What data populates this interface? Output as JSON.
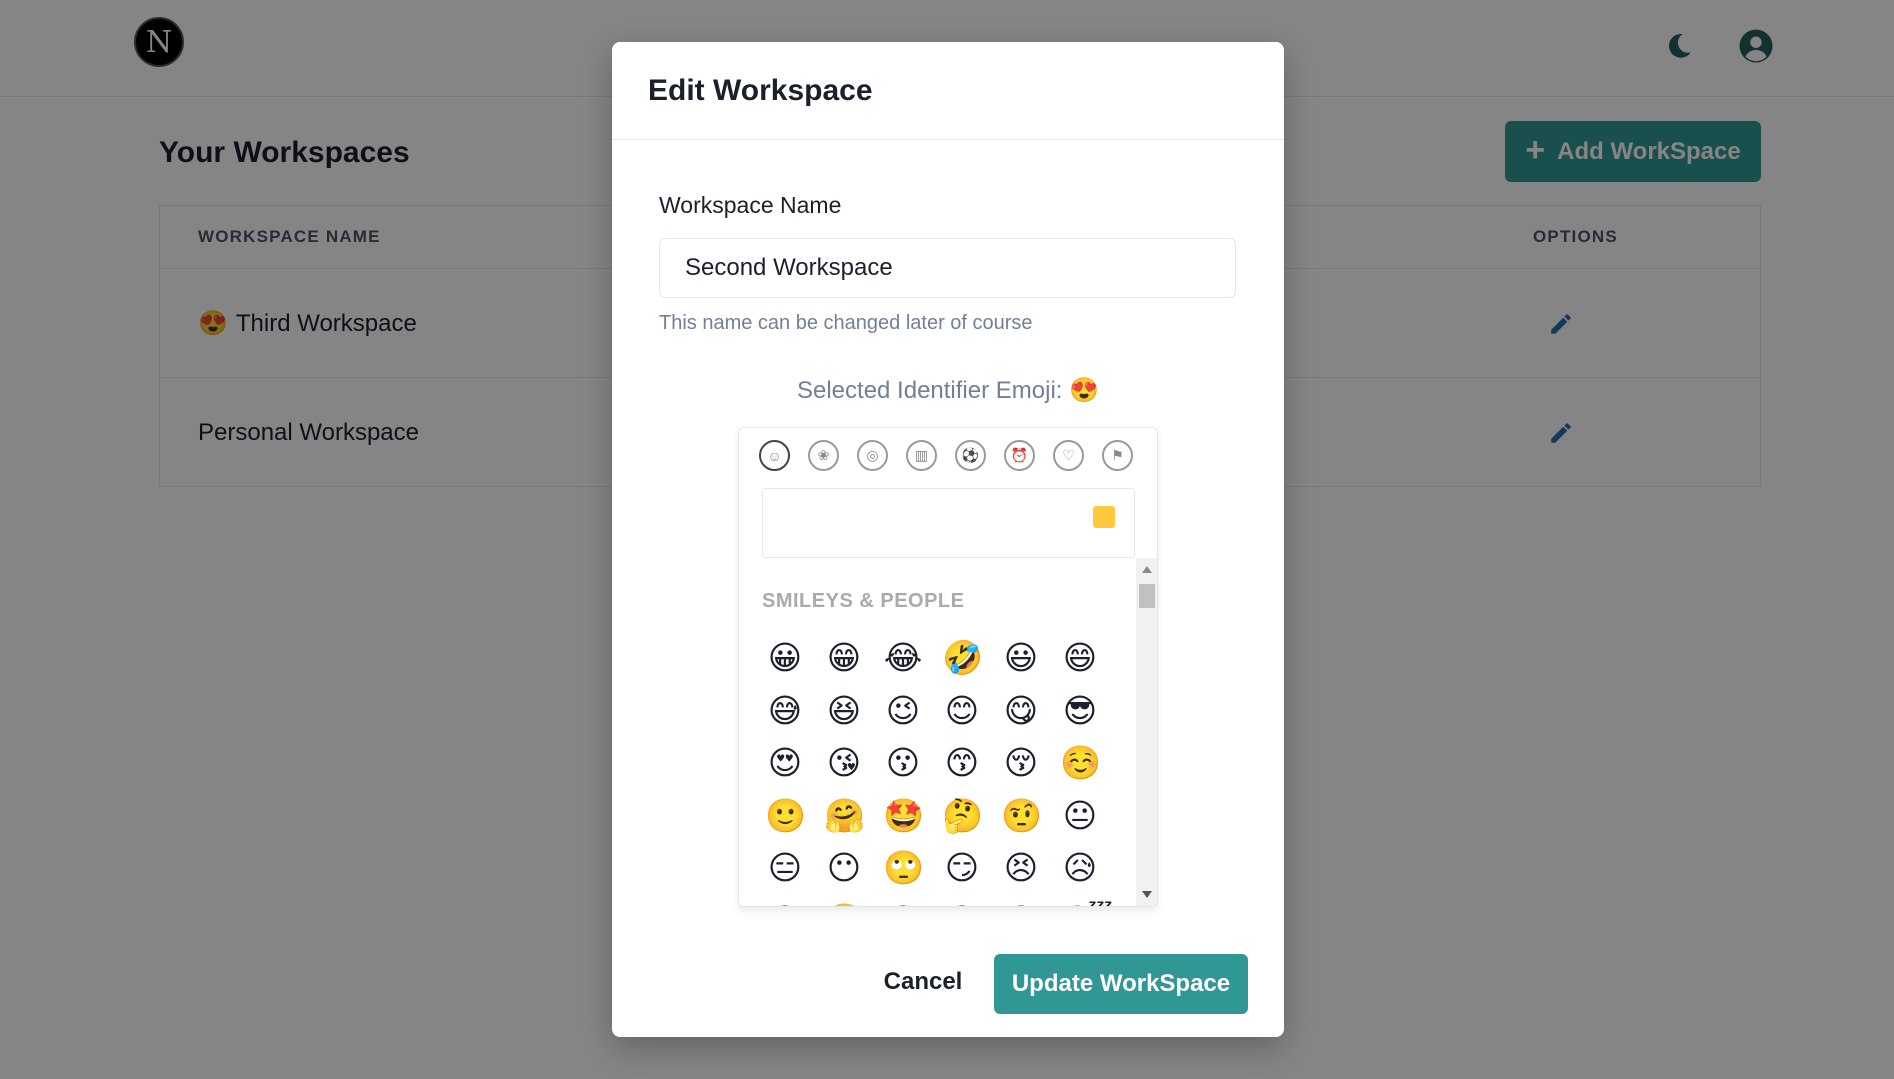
{
  "header": {
    "logo_letter": "N"
  },
  "page": {
    "title": "Your Workspaces",
    "add_button_label": "Add WorkSpace"
  },
  "table": {
    "columns": [
      "WORKSPACE NAME",
      "OPTIONS"
    ],
    "rows": [
      {
        "emoji": "😍",
        "name": "Third Workspace"
      },
      {
        "emoji": "",
        "name": "Personal Workspace"
      }
    ]
  },
  "modal": {
    "title": "Edit Workspace",
    "name_label": "Workspace Name",
    "name_value": "Second Workspace",
    "helper_text": "This name can be changed later of course",
    "selected_emoji_label": "Selected Identifier Emoji:",
    "selected_emoji": "😍",
    "cancel_label": "Cancel",
    "submit_label": "Update WorkSpace"
  },
  "emoji_picker": {
    "category_icons": [
      "people-icon",
      "nature-icon",
      "food-icon",
      "places-icon",
      "activity-icon",
      "objects-icon",
      "symbols-icon",
      "flags-icon"
    ],
    "section_title": "SMILEYS & PEOPLE",
    "skin_tone_color": "#ffc93a",
    "emojis": [
      "😀",
      "😁",
      "😂",
      "🤣",
      "😃",
      "😄",
      "😅",
      "😆",
      "😉",
      "😊",
      "😋",
      "😎",
      "😍",
      "😘",
      "😗",
      "😙",
      "😚",
      "☺️",
      "🙂",
      "🤗",
      "🤩",
      "🤔",
      "🤨",
      "😐",
      "😑",
      "😶",
      "🙄",
      "😏",
      "😣",
      "😥",
      "😮",
      "🤐",
      "😯",
      "😪",
      "😫",
      "😴"
    ]
  },
  "colors": {
    "accent": "#319795",
    "icon_blue": "#2b6cb0",
    "overlay": "rgba(0,0,0,0.48)"
  }
}
